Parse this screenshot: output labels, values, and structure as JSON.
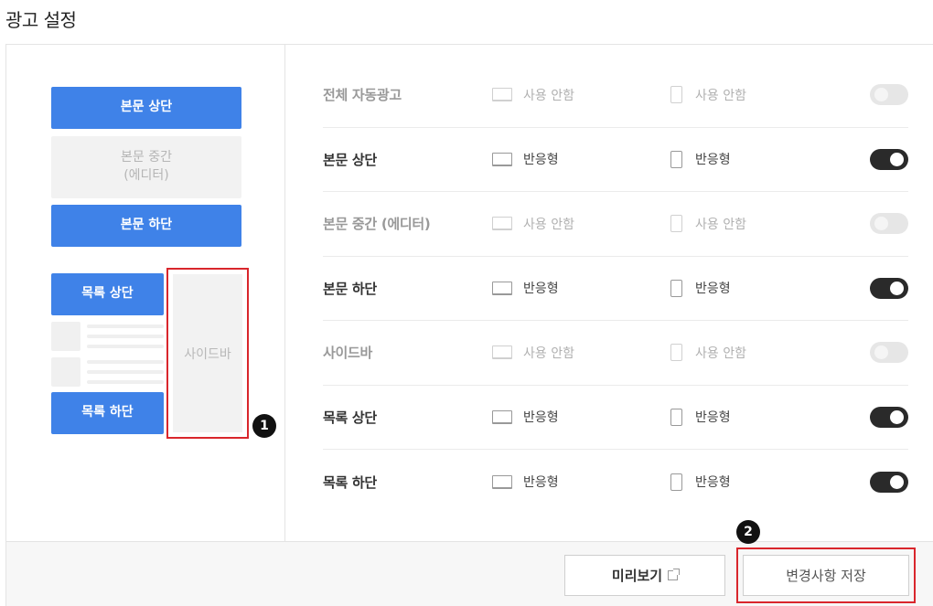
{
  "page": {
    "title": "광고 설정"
  },
  "preview": {
    "top_label": "본문 상단",
    "middle_label_line1": "본문 중간",
    "middle_label_line2": "(에디터)",
    "bottom_label": "본문 하단",
    "list_top_label": "목록 상단",
    "list_bottom_label": "목록 하단",
    "sidebar_label": "사이드바"
  },
  "markers": {
    "one": "1",
    "two": "2"
  },
  "settings": [
    {
      "label": "전체 자동광고",
      "pc": "사용 안함",
      "mobile": "사용 안함",
      "enabled": false
    },
    {
      "label": "본문 상단",
      "pc": "반응형",
      "mobile": "반응형",
      "enabled": true
    },
    {
      "label": "본문 중간 (에디터)",
      "pc": "사용 안함",
      "mobile": "사용 안함",
      "enabled": false
    },
    {
      "label": "본문 하단",
      "pc": "반응형",
      "mobile": "반응형",
      "enabled": true
    },
    {
      "label": "사이드바",
      "pc": "사용 안함",
      "mobile": "사용 안함",
      "enabled": false
    },
    {
      "label": "목록 상단",
      "pc": "반응형",
      "mobile": "반응형",
      "enabled": true
    },
    {
      "label": "목록 하단",
      "pc": "반응형",
      "mobile": "반응형",
      "enabled": true
    }
  ],
  "footer": {
    "preview_button": "미리보기",
    "save_button": "변경사항 저장"
  },
  "colors": {
    "accent": "#3f82e8",
    "highlight": "#d9262c",
    "toggle_on": "#2a2a2a",
    "toggle_off": "#e6e6e6"
  },
  "icons": {
    "pc": "monitor-icon",
    "mobile": "phone-icon",
    "external": "external-link-icon"
  }
}
